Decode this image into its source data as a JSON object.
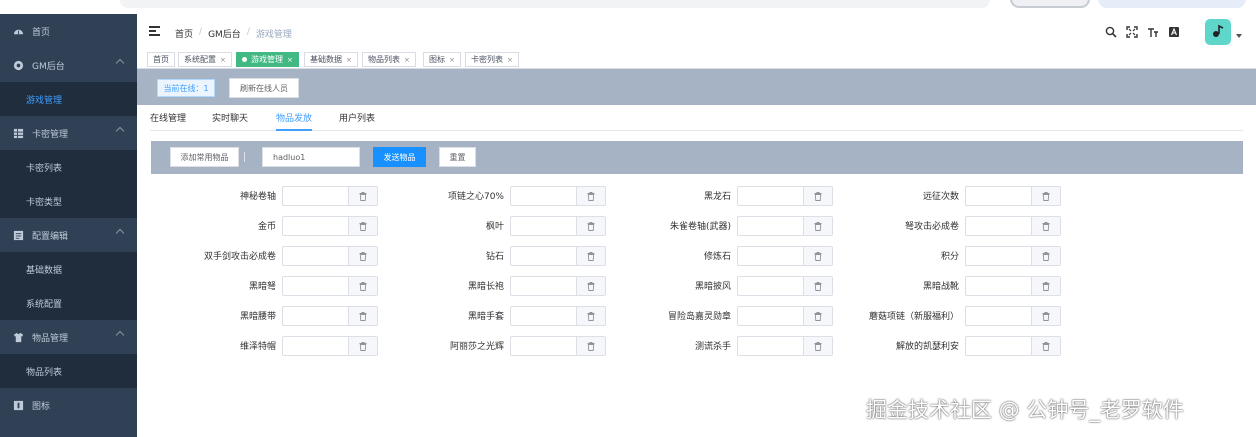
{
  "sidebar": {
    "home": "首页",
    "gm": {
      "label": "GM后台",
      "children": [
        "游戏管理"
      ]
    },
    "card": {
      "label": "卡密管理",
      "children": [
        "卡密列表",
        "卡密类型"
      ]
    },
    "config": {
      "label": "配置编辑",
      "children": [
        "基础数据",
        "系统配置"
      ]
    },
    "items": {
      "label": "物品管理",
      "children": [
        "物品列表"
      ]
    },
    "icons": {
      "label": "图标"
    }
  },
  "header": {
    "breadcrumb": [
      "首页",
      "GM后台",
      "游戏管理"
    ],
    "separator": "/",
    "text_size_glyph": "T",
    "lang_glyph": "A"
  },
  "tags_view": [
    {
      "label": "首页",
      "closable": false
    },
    {
      "label": "系统配置",
      "closable": true
    },
    {
      "label": "游戏管理",
      "closable": true,
      "active": true
    },
    {
      "label": "基础数据",
      "closable": true
    },
    {
      "label": "物品列表",
      "closable": true
    },
    {
      "label": "图标",
      "closable": true
    },
    {
      "label": "卡密列表",
      "closable": true
    }
  ],
  "panel": {
    "online_label": "当前在线：1",
    "refresh_label": "刷新在线人员"
  },
  "tabs": [
    "在线管理",
    "实时聊天",
    "物品发放",
    "用户列表"
  ],
  "active_tab": "物品发放",
  "action_bar": {
    "add_label": "添加常用物品",
    "player_value": "hadluo1",
    "send_label": "发送物品",
    "reset_label": "重置"
  },
  "item_rows": [
    [
      "神秘卷轴",
      "项链之心70%",
      "黑龙石",
      "远征次数"
    ],
    [
      "金币",
      "枫叶",
      "朱雀卷轴(武器)",
      "弩攻击必成卷"
    ],
    [
      "双手剑攻击必成卷",
      "钻石",
      "修炼石",
      "积分"
    ],
    [
      "黑暗弩",
      "黑暗长袍",
      "黑暗披风",
      "黑暗战靴"
    ],
    [
      "黑暗腰带",
      "黑暗手套",
      "冒险岛嘉灵勋章",
      "蘑菇项链（新服福利）"
    ],
    [
      "维泽特帽",
      "阿丽莎之光辉",
      "测谎杀手",
      "解放的凯瑟利安"
    ]
  ],
  "watermark": "掘金技术社区 @ 公钟号_老罗软件",
  "colors": {
    "sidebar_bg": "#304156",
    "submenu_bg": "#1f2d3d",
    "accent": "#409eff",
    "active_tag": "#42b983",
    "panel_bg": "#a6b3c4",
    "avatar_bg": "#5ed6c9"
  }
}
